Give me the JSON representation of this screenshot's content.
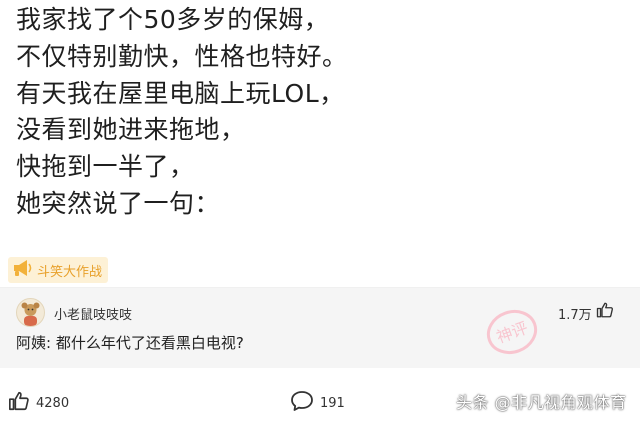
{
  "post": {
    "lines": [
      "我家找了个50多岁的保姆，",
      "不仅特别勤快，性格也特好。",
      "有天我在屋里电脑上玩LOL，",
      "没看到她进来拖地，",
      "快拖到一半了，",
      "她突然说了一句："
    ]
  },
  "tag": {
    "label": "斗笑大作战",
    "icon": "megaphone-icon",
    "color": "#e8a02a"
  },
  "comment": {
    "username": "小老鼠吱吱吱",
    "likes": "1.7万",
    "text": "阿姨: 都什么年代了还看黑白电视?",
    "stamp": "神评"
  },
  "footer": {
    "likes": "4280",
    "comments": "191"
  },
  "watermark": "头条 @非凡视角观体育"
}
